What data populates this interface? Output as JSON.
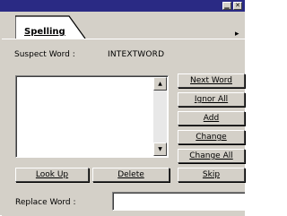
{
  "tabs": [
    {
      "label": "Spelling"
    }
  ],
  "title_buttons": {
    "minimize": "▁",
    "close": "✕"
  },
  "suspect": {
    "label": "Suspect Word :",
    "value": "INTEXTWORD"
  },
  "suggestions": {
    "items": []
  },
  "scroll": {
    "up": "▲",
    "down": "▼"
  },
  "buttons": {
    "next_word": "Next Word",
    "ignore_all": "Ignor All",
    "add": "Add",
    "change": "Change",
    "change_all": "Change All",
    "skip": "Skip",
    "look_up": "Look Up",
    "delete": "Delete"
  },
  "replace": {
    "label": "Replace Word :",
    "value": ""
  },
  "tab_scroll_arrow": "▸"
}
